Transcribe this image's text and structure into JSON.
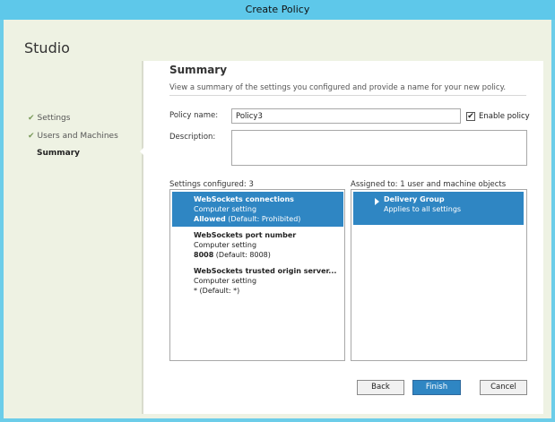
{
  "window": {
    "title": "Create Policy"
  },
  "sidebar": {
    "app_title": "Studio",
    "steps": [
      {
        "label": "Settings",
        "completed": true
      },
      {
        "label": "Users and Machines",
        "completed": true
      },
      {
        "label": "Summary",
        "completed": false,
        "active": true
      }
    ]
  },
  "main": {
    "title": "Summary",
    "subtitle": "View a summary of the settings you configured and provide a name for your new policy.",
    "policy_name_label": "Policy name:",
    "policy_name_value": "Policy3",
    "enable_policy_label": "Enable policy",
    "enable_policy_checked": true,
    "description_label": "Description:",
    "description_value": "",
    "settings_header": "Settings configured: 3",
    "settings": [
      {
        "name": "WebSockets connections",
        "type": "Computer setting",
        "value_bold": "Allowed",
        "value_rest": " (Default: Prohibited)",
        "selected": true
      },
      {
        "name": "WebSockets port number",
        "type": "Computer setting",
        "value_bold": "8008",
        "value_rest": " (Default: 8008)",
        "selected": false
      },
      {
        "name": "WebSockets trusted origin server...",
        "type": "Computer setting",
        "value_bold": "*",
        "value_rest": " (Default: *)",
        "selected": false
      }
    ],
    "assigned_header": "Assigned to: 1 user and machine objects",
    "assigned": [
      {
        "name": "Delivery Group",
        "detail": "Applies to all settings"
      }
    ]
  },
  "footer": {
    "back_label": "Back",
    "finish_label": "Finish",
    "cancel_label": "Cancel"
  },
  "colors": {
    "titlebar": "#5ec8ea",
    "selection": "#2f86c3",
    "background": "#eef2e3"
  }
}
